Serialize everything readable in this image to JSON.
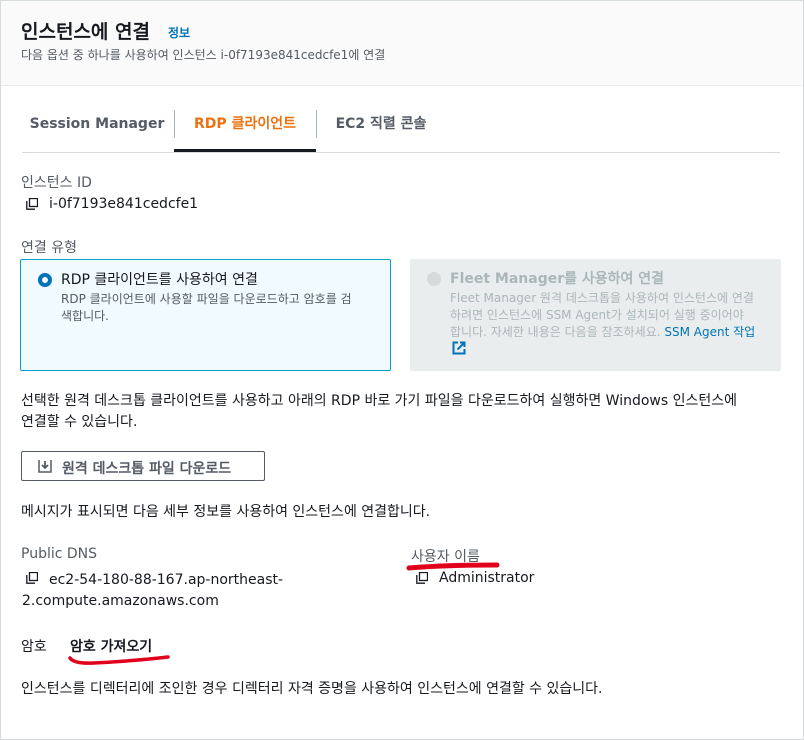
{
  "header": {
    "title": "인스턴스에 연결",
    "info_link": "정보",
    "description": "다음 옵션 중 하나를 사용하여 인스턴스 i-0f7193e841cedcfe1에 연결"
  },
  "tabs": [
    {
      "label": "Session Manager",
      "active": false
    },
    {
      "label": "RDP 클라이언트",
      "active": true
    },
    {
      "label": "EC2 직렬 콘솔",
      "active": false
    }
  ],
  "instance": {
    "id_label": "인스턴스 ID",
    "id_value": "i-0f7193e841cedcfe1"
  },
  "connection_type": {
    "label": "연결 유형",
    "options": [
      {
        "title": "RDP 클라이언트를 사용하여 연결",
        "desc_line1": "RDP 클라이언트에 사용할 파일을 다운로드하고 암호를 검",
        "desc_line2": "색합니다.",
        "selected": true
      },
      {
        "title": "Fleet Manager를 사용하여 연결",
        "desc_line1": "Fleet Manager 원격 데스크톱을 사용하여 인스턴스에 연결",
        "desc_line2": "하려면 인스턴스에 SSM Agent가 설치되어 실행 중이어야",
        "desc_line3": "합니다. 자세한 내용은 다음을 참조하세요.",
        "link": "SSM Agent 작업",
        "selected": false,
        "disabled": true
      }
    ]
  },
  "instructions": {
    "line1": "선택한 원격 데스크톱 클라이언트를 사용하고 아래의 RDP 바로 가기 파일을 다운로드하여 실행하면 Windows 인스턴스에",
    "line2": "연결할 수 있습니다."
  },
  "download_button": "원격 데스크톱 파일 다운로드",
  "prompt_text": "메시지가 표시되면 다음 세부 정보를 사용하여 인스턴스에 연결합니다.",
  "details": {
    "dns_label": "Public DNS",
    "dns_line1": "ec2-54-180-88-167.ap-northeast-",
    "dns_line2": "2.compute.amazonaws.com",
    "username_label": "사용자 이름",
    "username_value": "Administrator"
  },
  "password": {
    "label": "암호",
    "link": "암호 가져오기"
  },
  "footer_text": "인스턴스를 디렉터리에 조인한 경우 디렉터리 자격 증명을 사용하여 인스턴스에 연결할 수 있습니다.",
  "colors": {
    "accent_orange": "#ec7211",
    "link_blue": "#0073bb",
    "annotation_red": "#e0001b"
  }
}
